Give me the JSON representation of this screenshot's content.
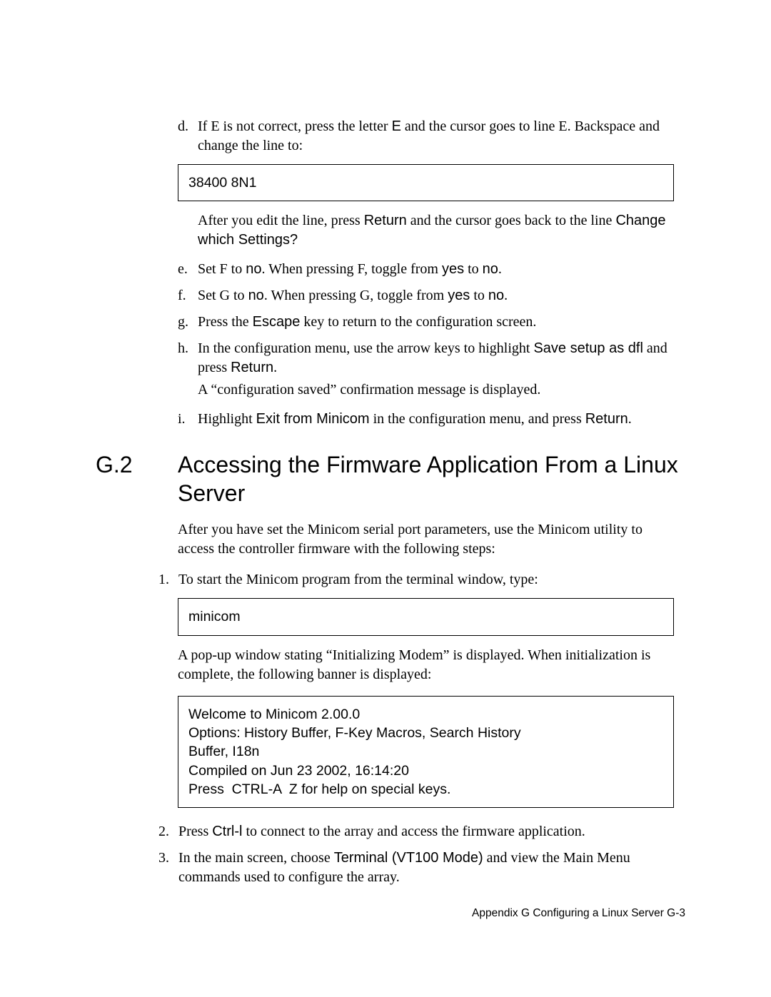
{
  "steps": {
    "d": {
      "marker": "d.",
      "text_before_E": "If E is not correct, press the letter ",
      "E": "E",
      "text_after_E": " and the cursor goes to line E. Backspace and change the line to:"
    },
    "code38400": "38400 8N1",
    "afterEdit": {
      "pre": "After you edit the line, press ",
      "return": "Return",
      "mid": " and the cursor goes back to the line ",
      "change": "Change which Settings?"
    },
    "e": {
      "marker": "e.",
      "pre": "Set F to ",
      "no1": "no",
      "mid": ". When pressing F, toggle from ",
      "yes": "yes",
      "to": " to ",
      "no2": "no",
      "end": "."
    },
    "f": {
      "marker": "f.",
      "pre": "Set G to ",
      "no1": "no",
      "mid": ". When pressing G, toggle from ",
      "yes": "yes",
      "to": " to ",
      "no2": "no",
      "end": "."
    },
    "g": {
      "marker": "g.",
      "pre": "Press the ",
      "escape": "Escape",
      "post": " key to return to the configuration screen."
    },
    "h": {
      "marker": "h.",
      "pre": "In the configuration menu, use the arrow keys to highlight ",
      "save": "Save setup as dfl",
      "mid": " and press ",
      "return": "Return",
      "end": ".",
      "confirm": "A “configuration saved” confirmation message is displayed."
    },
    "i": {
      "marker": "i.",
      "pre": "Highlight ",
      "exit": "Exit from Minicom",
      "mid": " in the configuration menu, and press ",
      "return": "Return",
      "end": "."
    }
  },
  "section": {
    "num": "G.2",
    "title": "Accessing the Firmware Application From a Linux Server",
    "intro": "After you have set the Minicom serial port parameters, use the Minicom utility to access the controller firmware with the following steps:"
  },
  "numbered": {
    "one": {
      "marker": "1.",
      "text": "To start the Minicom program from the terminal window, type:"
    },
    "minicom_cmd": "minicom",
    "popup": "A pop-up window stating “Initializing Modem” is displayed. When initialization is complete, the following banner is displayed:",
    "banner": "Welcome to Minicom 2.00.0\nOptions: History Buffer, F-Key Macros, Search History\nBuffer, I18n\nCompiled on Jun 23 2002, 16:14:20\nPress  CTRL-A  Z for help on special keys.",
    "two": {
      "marker": "2.",
      "pre": "Press ",
      "ctrl": "Ctrl-l",
      "post": " to connect to the array and access the firmware application."
    },
    "three": {
      "marker": "3.",
      "pre": "In the main screen, choose ",
      "term": "Terminal (VT100 Mode)",
      "post": " and view the Main Menu commands used to configure the array."
    }
  },
  "footer": "Appendix G   Configuring a Linux Server G-3"
}
